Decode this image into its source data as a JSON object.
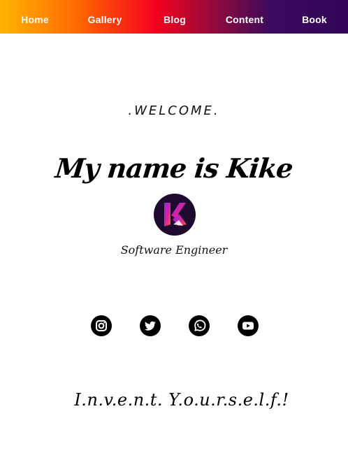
{
  "nav": {
    "items": [
      {
        "label": "Home"
      },
      {
        "label": "Gallery"
      },
      {
        "label": "Blog"
      },
      {
        "label": "Content"
      },
      {
        "label": "Book"
      }
    ],
    "gradient_colors": [
      "#ffb300",
      "#ff6a00",
      "#f3001d",
      "#8f0b3e",
      "#3b0a5c",
      "#330657"
    ]
  },
  "hero": {
    "welcome": ".WELCOME.",
    "title": "My name is Kike",
    "logo_icon": "k-monogram-logo",
    "subtitle": "Software Engineer"
  },
  "social": {
    "icons": [
      "instagram-icon",
      "twitter-icon",
      "whatsapp-icon",
      "youtube-icon"
    ],
    "color": "#000000"
  },
  "motto": "I.n.v.e.n.t. Y.o.u.r.s.e.l.f.!"
}
